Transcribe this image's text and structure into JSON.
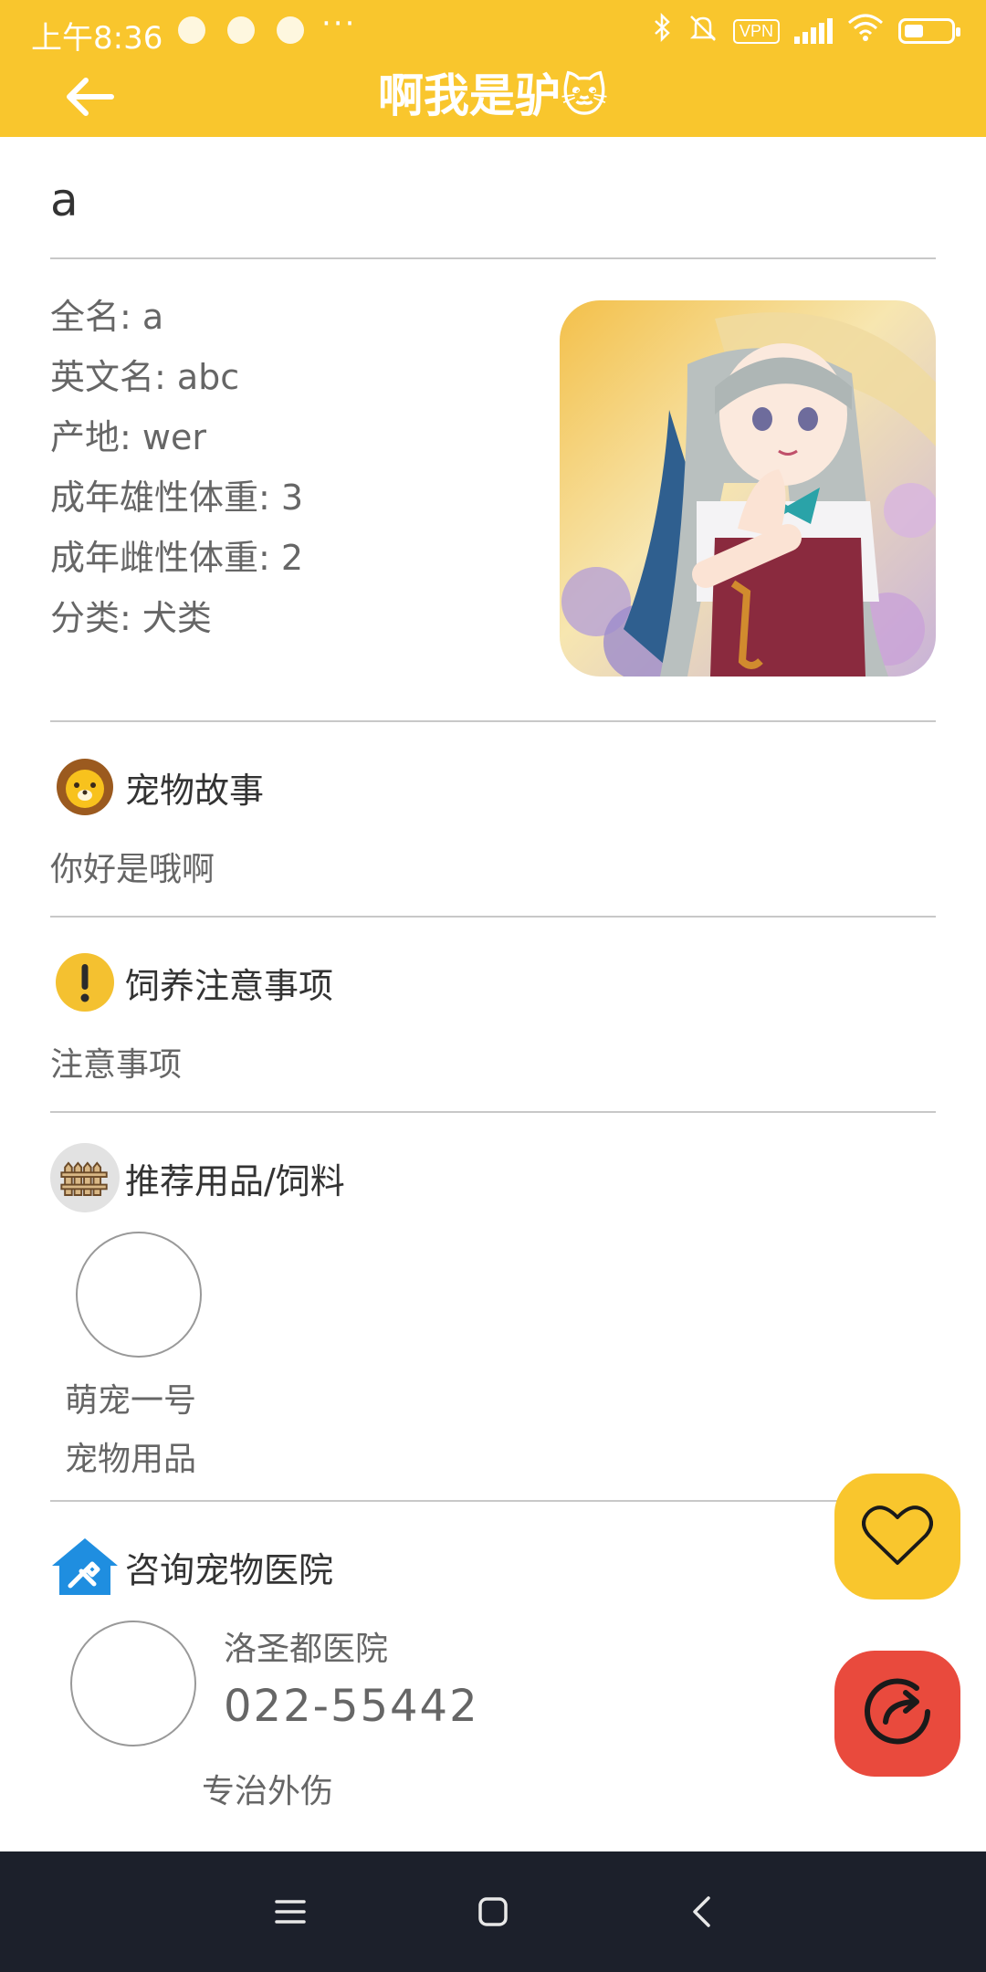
{
  "status_bar": {
    "time": "上午8:36",
    "more": "···",
    "vpn": "VPN",
    "left_icons": [
      "hotspot-icon",
      "app-notification-icon",
      "app-notification-icon"
    ],
    "right_icons": [
      "bluetooth-icon",
      "mute-icon",
      "vpn-icon",
      "signal-icon",
      "wifi-icon",
      "battery-icon"
    ]
  },
  "app_bar": {
    "title": "啊我是驴🐱",
    "back_icon": "arrow-left-icon"
  },
  "pet": {
    "short_name": "a",
    "fields": [
      "全名: a",
      "英文名: abc",
      "产地: wer",
      "成年雄性体重: 3",
      "成年雌性体重: 2",
      "分类: 犬类"
    ],
    "photo": "anime-girl-umbrella-image"
  },
  "sections": {
    "story": {
      "title": "宠物故事",
      "body": "你好是哦啊",
      "icon": "lion-icon"
    },
    "care": {
      "title": "饲养注意事项",
      "body": "注意事项",
      "icon": "warning-icon"
    },
    "supplies": {
      "title": "推荐用品/饲料",
      "icon": "fence-icon",
      "items": [
        {
          "name": "萌宠一号",
          "category": "宠物用品"
        }
      ]
    },
    "hospital": {
      "title": "咨询宠物医院",
      "icon": "hospital-icon",
      "name": "洛圣都医院",
      "phone": "022-55442",
      "specialty": "专治外伤"
    }
  },
  "fabs": {
    "favorite_icon": "heart-icon",
    "share_icon": "share-icon",
    "favorite_color": "#f9c62d",
    "share_color": "#e94a3d"
  },
  "theme": {
    "accent": "#f9c62d",
    "nav_bg": "#1c202b"
  },
  "nav_bar": {
    "icons": [
      "menu-icon",
      "home-icon",
      "back-icon"
    ]
  }
}
